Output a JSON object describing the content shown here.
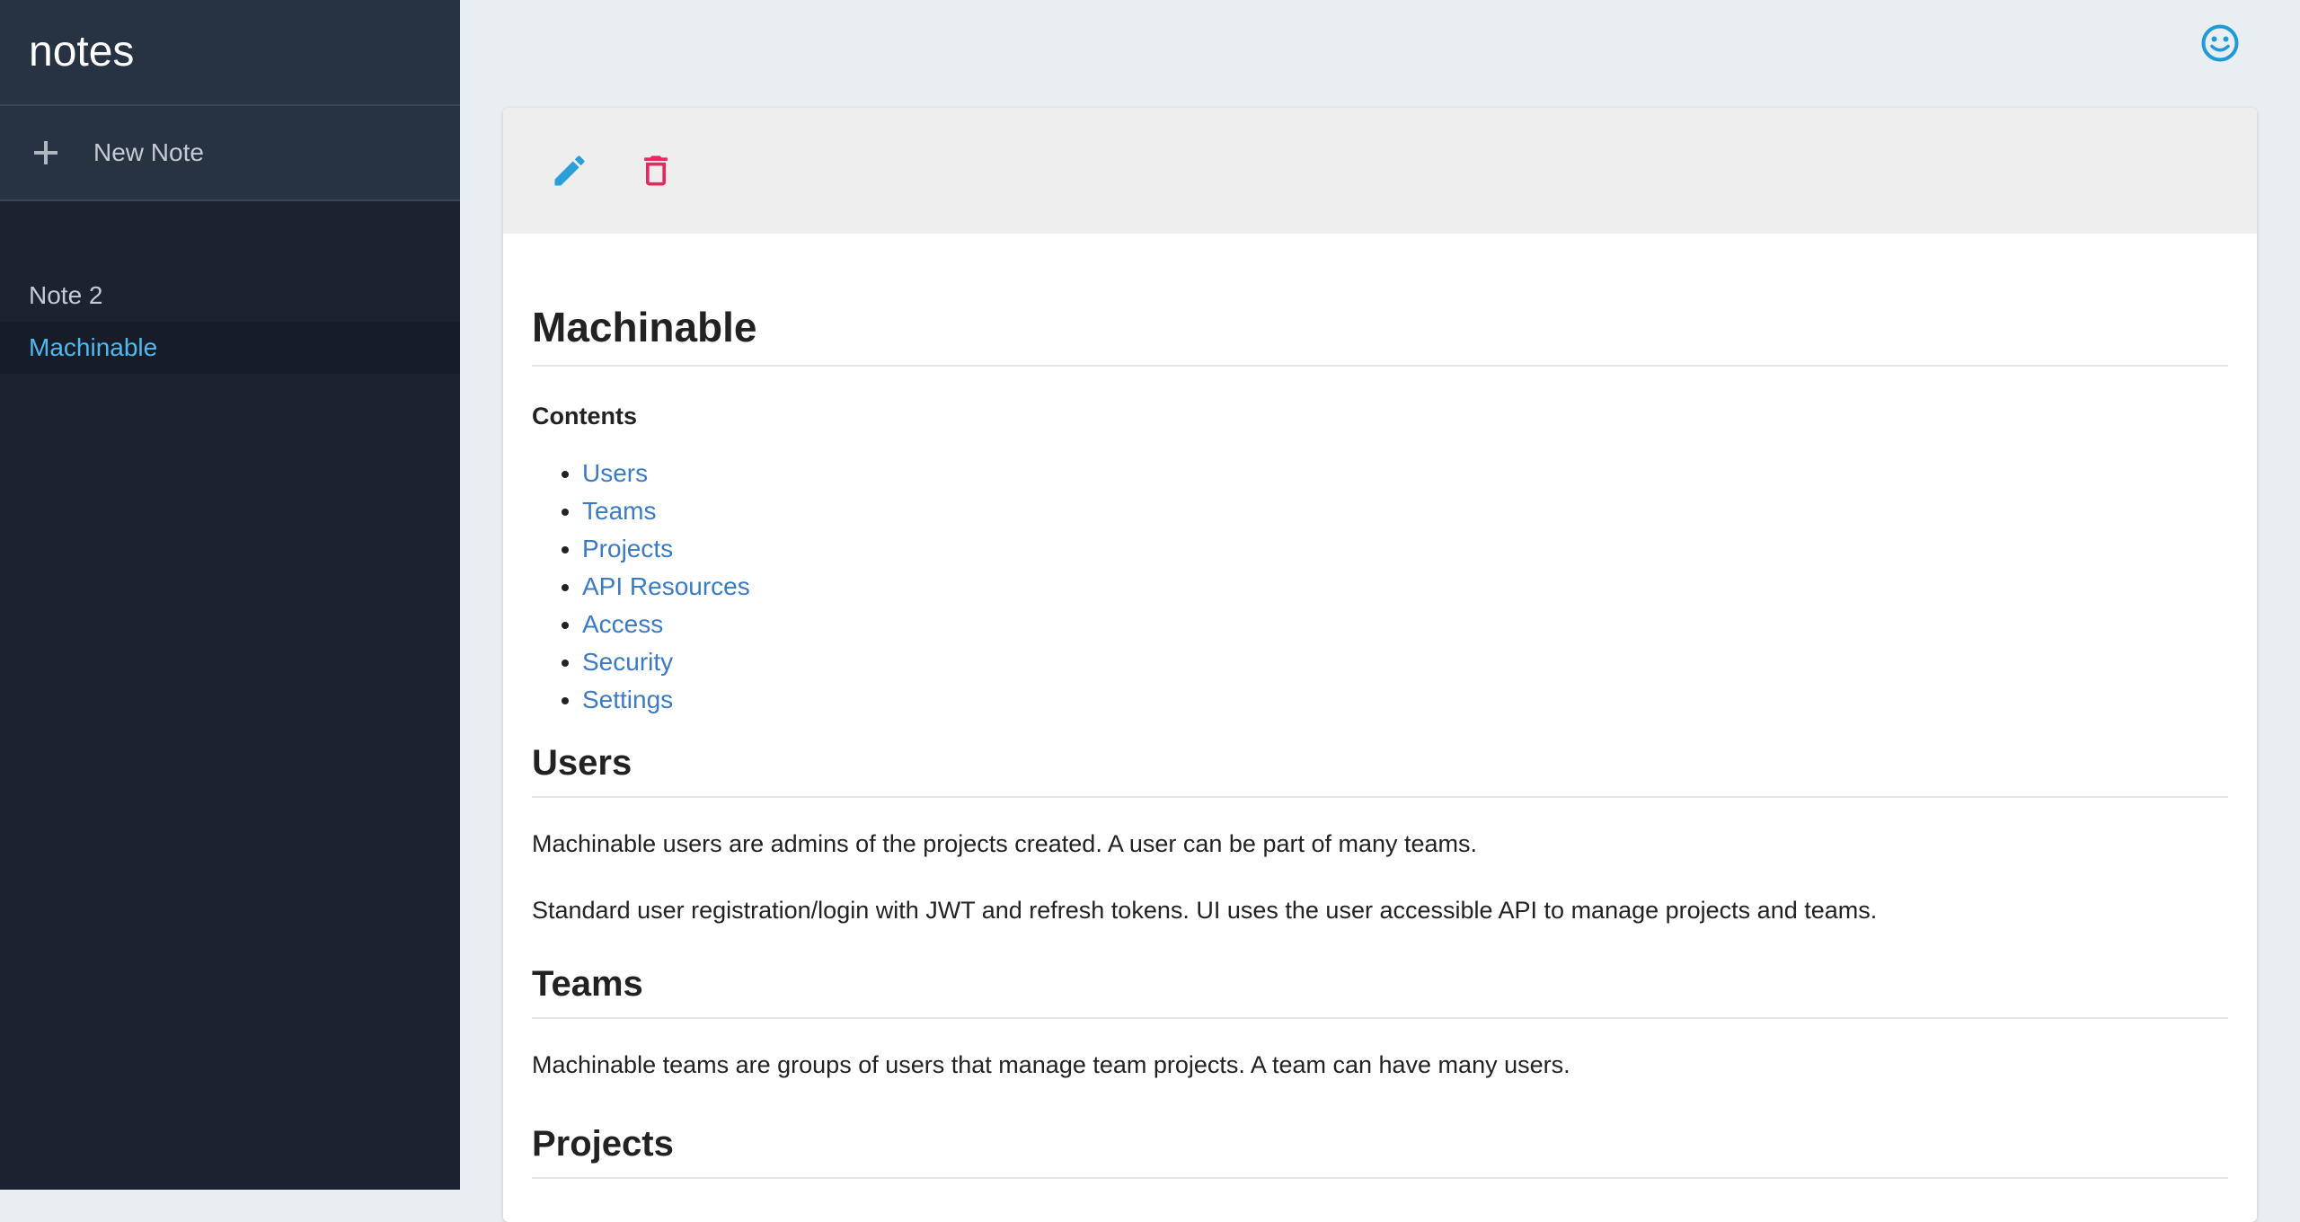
{
  "sidebar": {
    "app_title": "notes",
    "new_note_label": "New Note",
    "notes": [
      {
        "label": "Note 2",
        "active": false
      },
      {
        "label": "Machinable",
        "active": true
      }
    ]
  },
  "toolbar": {
    "edit_icon": "pencil-icon",
    "delete_icon": "trash-icon"
  },
  "header": {
    "user_icon": "smiley-face-icon"
  },
  "note": {
    "title": "Machinable",
    "contents_label": "Contents",
    "toc": [
      "Users",
      "Teams",
      "Projects",
      "API Resources",
      "Access",
      "Security",
      "Settings"
    ],
    "sections": [
      {
        "heading": "Users",
        "paragraphs": [
          "Machinable users are admins of the projects created. A user can be part of many teams.",
          "Standard user registration/login with JWT and refresh tokens. UI uses the user accessible API to manage projects and teams."
        ]
      },
      {
        "heading": "Teams",
        "paragraphs": [
          "Machinable teams are groups of users that manage team projects. A team can have many users."
        ]
      },
      {
        "heading": "Projects",
        "paragraphs": []
      }
    ]
  },
  "colors": {
    "sidebar_bg": "#1b2331",
    "sidebar_header_bg": "#273243",
    "active_link": "#4fb8ee",
    "edit_icon": "#2a9fd8",
    "delete_icon": "#e8275e",
    "user_icon": "#1e9ad6",
    "link": "#3c7ac1"
  }
}
